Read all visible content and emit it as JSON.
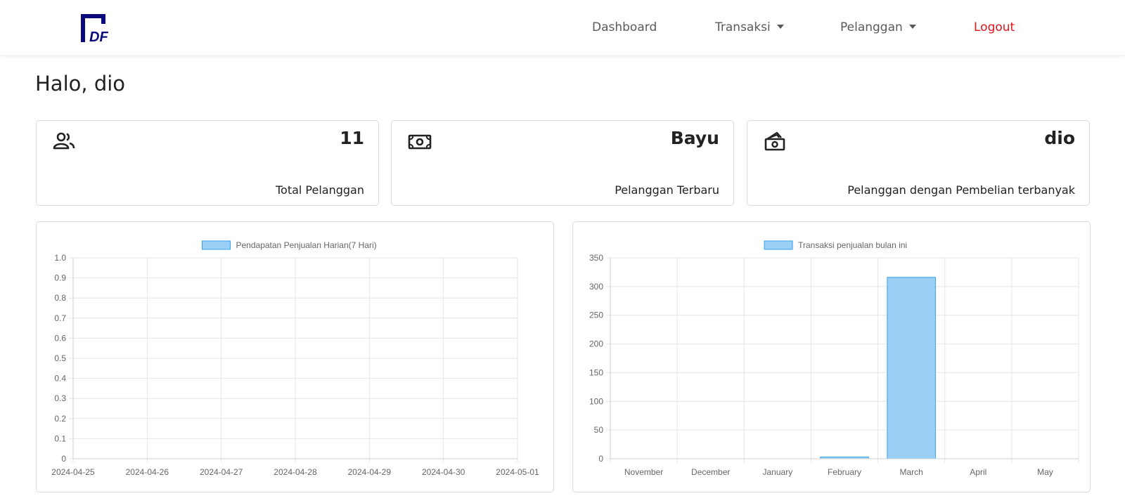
{
  "nav": {
    "brand_text": "DF",
    "dashboard": "Dashboard",
    "transaksi": "Transaksi",
    "pelanggan": "Pelanggan",
    "logout": "Logout"
  },
  "greeting": "Halo, dio",
  "cards": [
    {
      "icon": "users-icon",
      "value": "11",
      "label": "Total Pelanggan"
    },
    {
      "icon": "money-bill-icon",
      "value": "Bayu",
      "label": "Pelanggan Terbaru"
    },
    {
      "icon": "money-hand-icon",
      "value": "dio",
      "label": "Pelanggan dengan Pembelian terbanyak"
    }
  ],
  "colors": {
    "bar_fill": "#9ad0f5",
    "bar_border": "#36a2eb",
    "logout": "#e0131a",
    "logo": "#0a0a7a"
  },
  "chart_data": [
    {
      "type": "bar",
      "categories": [
        "2024-04-25",
        "2024-04-26",
        "2024-04-27",
        "2024-04-28",
        "2024-04-29",
        "2024-04-30",
        "2024-05-01"
      ],
      "series": [
        {
          "name": "Pendapatan Penjualan Harian(7 Hari)",
          "values": [
            0,
            0,
            0,
            0,
            0,
            0,
            0
          ]
        }
      ],
      "ylim": [
        0,
        1
      ],
      "yticks": [
        "0",
        "0.1",
        "0.2",
        "0.3",
        "0.4",
        "0.5",
        "0.6",
        "0.7",
        "0.8",
        "0.9",
        "1.0"
      ],
      "legend": "top",
      "grid": true
    },
    {
      "type": "bar",
      "categories": [
        "November",
        "December",
        "January",
        "February",
        "March",
        "April",
        "May"
      ],
      "series": [
        {
          "name": "Transaksi penjualan bulan ini",
          "values": [
            0,
            0,
            0,
            3,
            316,
            0,
            0
          ]
        }
      ],
      "ylim": [
        0,
        350
      ],
      "yticks": [
        "0",
        "50",
        "100",
        "150",
        "200",
        "250",
        "300",
        "350"
      ],
      "legend": "top",
      "grid": true
    }
  ]
}
